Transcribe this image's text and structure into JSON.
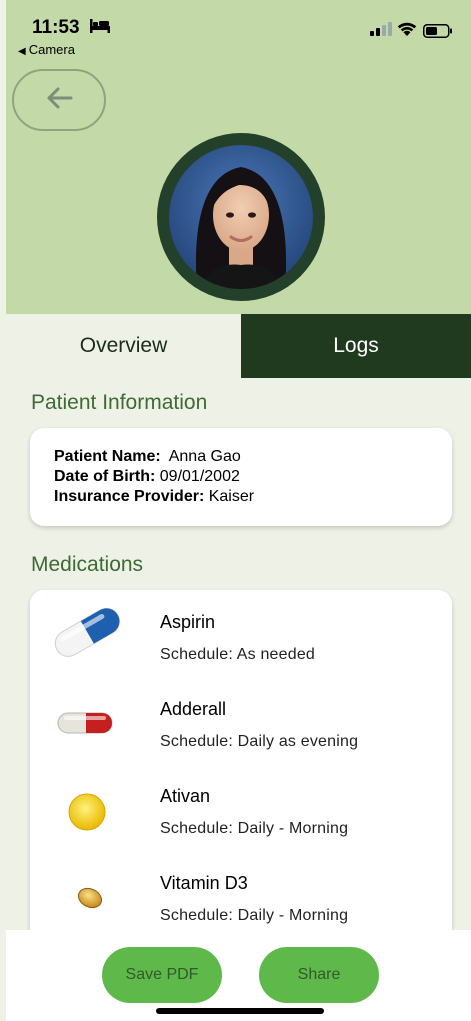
{
  "status_bar": {
    "time": "11:53",
    "back_app": "Camera"
  },
  "header": {
    "back_icon": "arrow-left-icon",
    "avatar_alt": "patient-photo"
  },
  "tabs": [
    {
      "label": "Overview",
      "selected": true
    },
    {
      "label": "Logs",
      "selected": false
    }
  ],
  "patient_info": {
    "title": "Patient Information",
    "name_label": "Patient Name:",
    "name_value": "Anna Gao",
    "dob_label": "Date of Birth:",
    "dob_value": "09/01/2002",
    "insurance_label": "Insurance Provider:",
    "insurance_value": "Kaiser"
  },
  "medications": {
    "title": "Medications",
    "items": [
      {
        "name": "Aspirin",
        "schedule": "Schedule: As needed",
        "icon": "blue-white-capsule-icon"
      },
      {
        "name": "Adderall",
        "schedule": "Schedule: Daily as evening",
        "icon": "red-white-capsule-icon"
      },
      {
        "name": "Ativan",
        "schedule": "Schedule: Daily - Morning",
        "icon": "yellow-round-pill-icon"
      },
      {
        "name": "Vitamin D3",
        "schedule": "Schedule: Daily - Morning",
        "icon": "softgel-pill-icon"
      }
    ]
  },
  "footer": {
    "save_label": "Save PDF",
    "share_label": "Share"
  },
  "colors": {
    "header_bg": "#c3d9a8",
    "page_bg": "#eef2e6",
    "tab_selected_dark": "#203a20",
    "section_title": "#3d6a35",
    "button_green": "#5fb84a"
  }
}
